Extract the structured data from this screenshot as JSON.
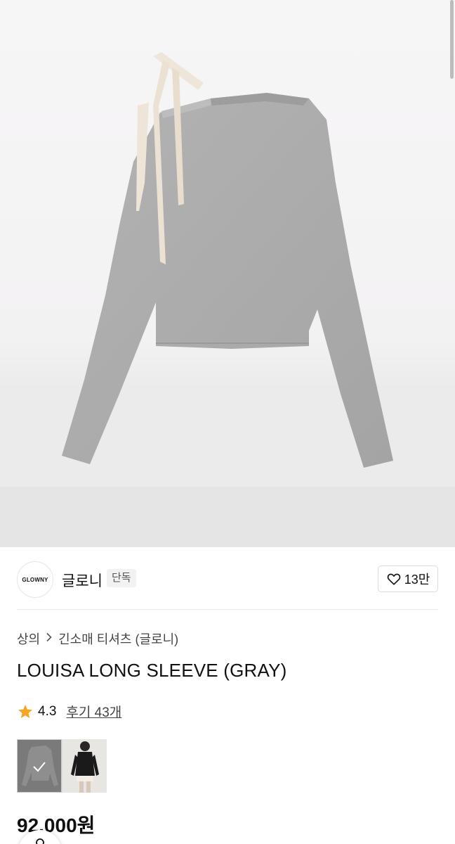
{
  "brand": {
    "logo_text": "GLOWNY",
    "name": "글로니",
    "badge": "단독"
  },
  "like": {
    "icon": "heart-outline-icon",
    "count": "13만"
  },
  "breadcrumb": {
    "level1": "상의",
    "separator_icon": "chevron-right-icon",
    "level2": "긴소매 티셔츠 (글로니)"
  },
  "product": {
    "title": "LOUISA LONG SLEEVE (GRAY)",
    "rating": "4.3",
    "review_label": "후기 43개",
    "price": "92,000원"
  },
  "variants": [
    {
      "name": "gray",
      "selected": true
    },
    {
      "name": "black",
      "selected": false
    }
  ],
  "colors": {
    "star": "#f5a623",
    "garment": "#a9a9a9",
    "ribbon": "#efe6da"
  }
}
